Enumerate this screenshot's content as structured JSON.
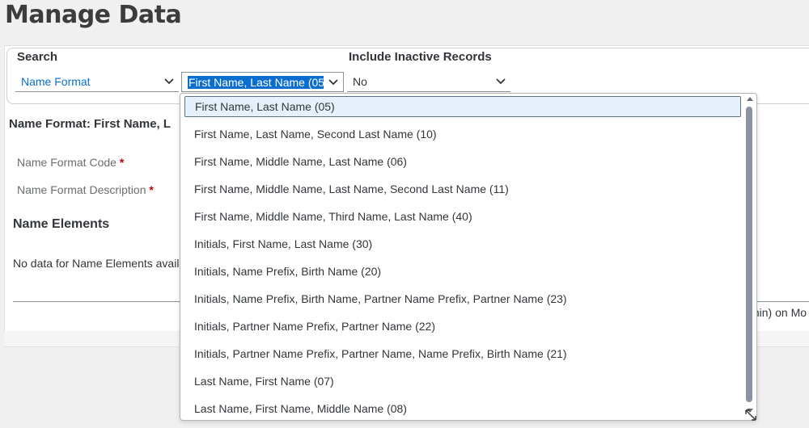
{
  "page": {
    "title": "Manage Data"
  },
  "search": {
    "label": "Search",
    "field_select": {
      "value": "Name Format"
    },
    "value_select": {
      "value": "First Name, Last Name (05)"
    },
    "inactive_label": "Include Inactive Records",
    "inactive_select": {
      "value": "No"
    }
  },
  "detail": {
    "title": "Name Format: First Name, L",
    "fields": [
      {
        "label": "Name Format Code",
        "required": "*"
      },
      {
        "label": "Name Format Description",
        "required": "*"
      }
    ],
    "section_title": "Name Elements",
    "no_data_text": "No data for Name Elements availa",
    "footer_text": "min) on Mo"
  },
  "dropdown": {
    "items": [
      {
        "label": "First Name, Last Name (05)",
        "selected": true
      },
      {
        "label": "First Name, Last Name, Second Last Name (10)"
      },
      {
        "label": "First Name, Middle Name, Last Name (06)"
      },
      {
        "label": "First Name, Middle Name, Last Name, Second Last Name (11)"
      },
      {
        "label": "First Name, Middle Name, Third Name, Last Name (40)"
      },
      {
        "label": "Initials, First Name, Last Name (30)"
      },
      {
        "label": "Initials, Name Prefix, Birth Name (20)"
      },
      {
        "label": "Initials, Name Prefix, Birth Name, Partner Name Prefix, Partner Name (23)"
      },
      {
        "label": "Initials, Partner Name Prefix, Partner Name (22)"
      },
      {
        "label": "Initials, Partner Name Prefix, Partner Name, Name Prefix, Birth Name (21)"
      },
      {
        "label": "Last Name, First Name (07)"
      },
      {
        "label": "Last Name, First Name, Middle Name (08)"
      }
    ]
  },
  "colors": {
    "accent": "#0a6ed1",
    "required": "#bb0000",
    "selected_bg": "#e5f0fa"
  },
  "icons": {
    "chevron": "chevron-down-icon",
    "resize": "resize-handle-icon"
  }
}
